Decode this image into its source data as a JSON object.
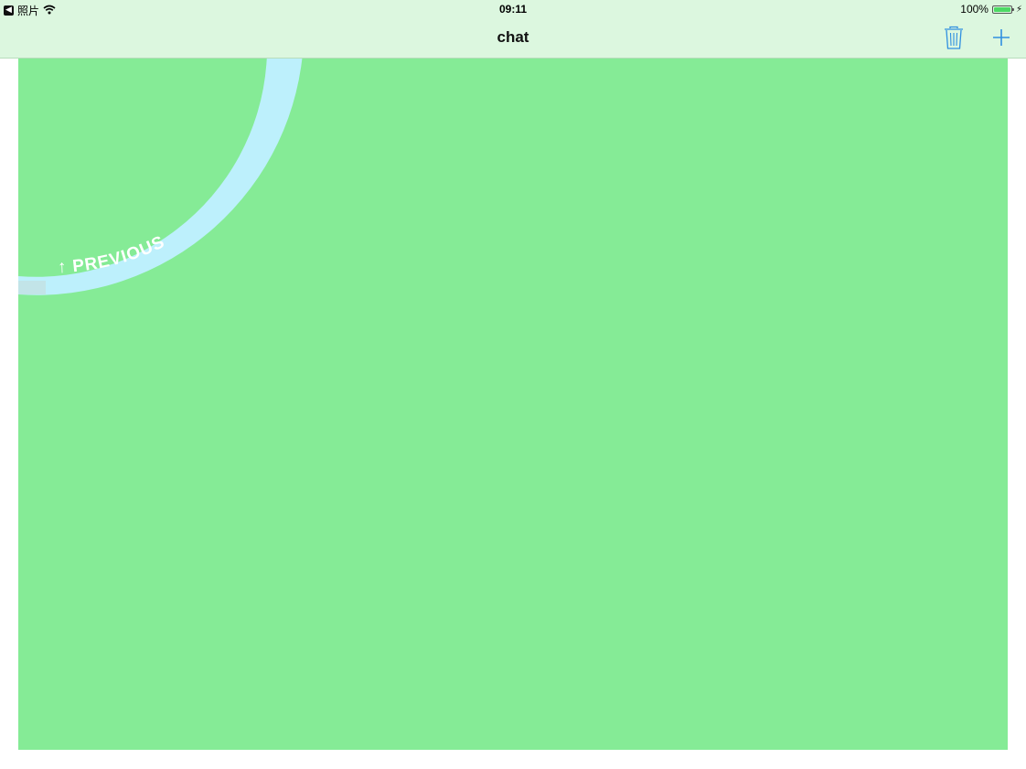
{
  "status_bar": {
    "back_app": "照片",
    "back_glyph": "◀",
    "time": "09:11",
    "battery_percent": "100%",
    "battery_level": 1.0
  },
  "nav": {
    "title": "chat",
    "trash_icon": "trash-icon",
    "add_icon": "plus-icon"
  },
  "pull_indicator": {
    "label": "↑ PREVIOUS"
  },
  "colors": {
    "bar_background": "#dcf7df",
    "content_background": "#85eb96",
    "arc_color": "#bdf0fc",
    "accent": "#2f8fe0"
  }
}
